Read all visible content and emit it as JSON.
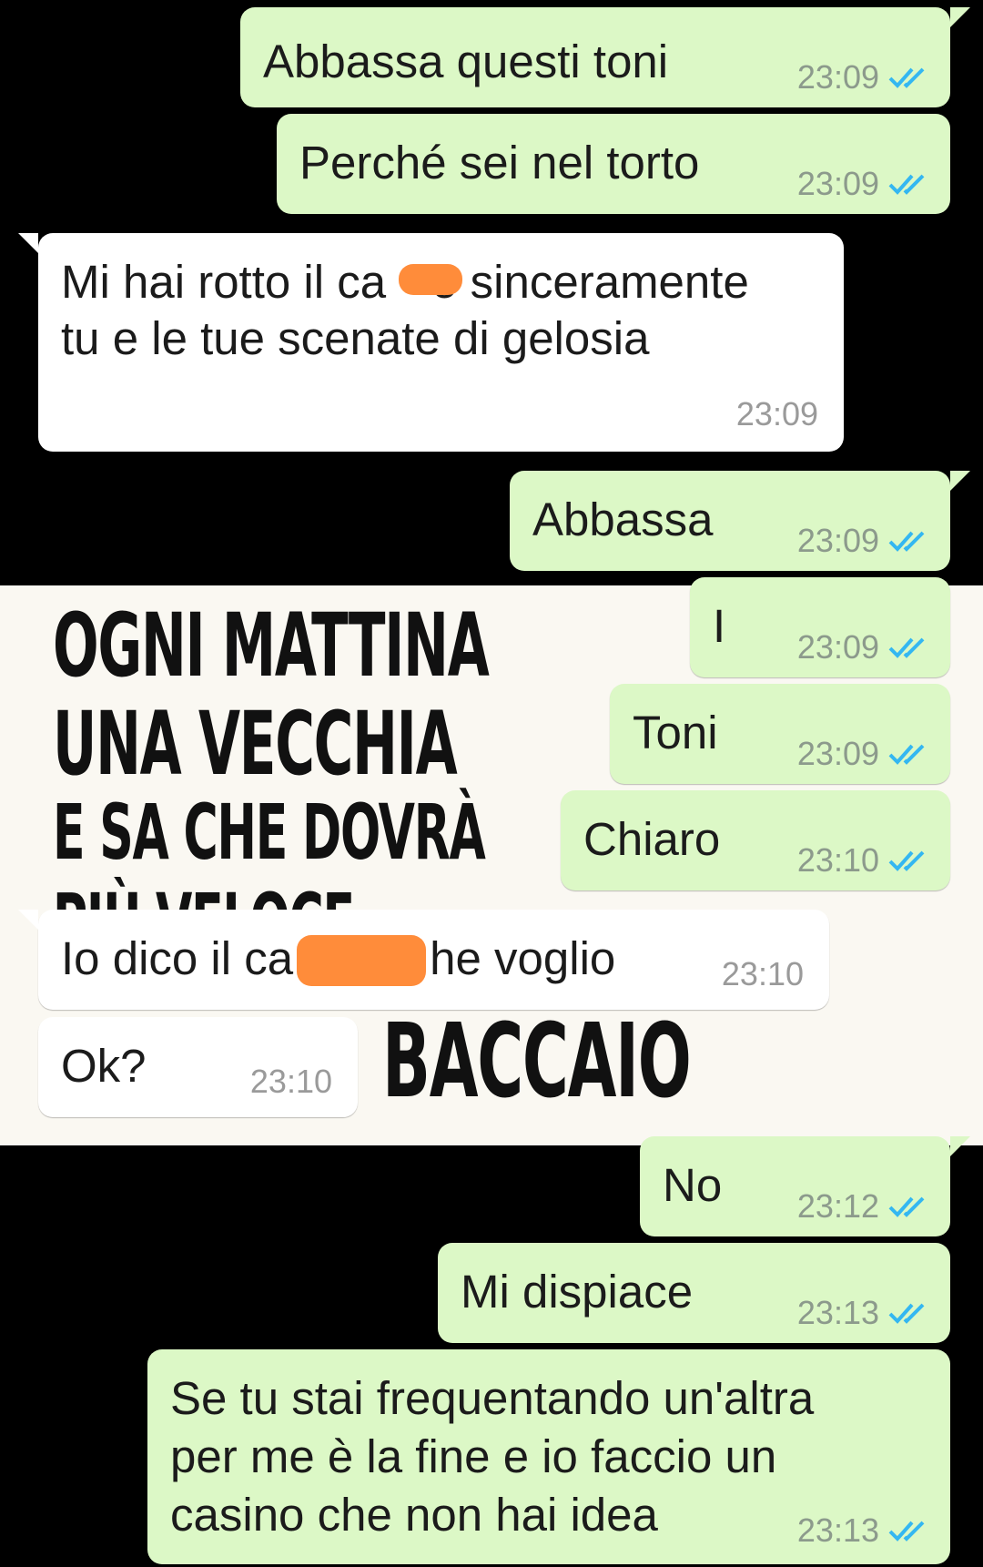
{
  "colors": {
    "background": "#000000",
    "outgoing_bubble": "#dcf8c6",
    "incoming_bubble": "#ffffff",
    "read_ticks": "#34b7f1",
    "redaction": "#ff8c3a",
    "banner_background": "#faf8f2"
  },
  "background_image": {
    "lines": [
      "OGNI MATTINA",
      "UNA VECCHIA",
      "E SA CHE DOVRÀ",
      "PIÙ VELOCE",
      "",
      "BACCAIO"
    ]
  },
  "messages": [
    {
      "direction": "out",
      "text": "Abbassa questi toni",
      "time": "23:09",
      "status_icon": "double-check-read"
    },
    {
      "direction": "out",
      "text": "Perché sei nel torto",
      "time": "23:09",
      "status_icon": "double-check-read"
    },
    {
      "direction": "in",
      "line1": "Mi hai rotto il ca",
      "line1_after": "o sinceramente",
      "line2": "tu e le tue scenate di gelosia",
      "time": "23:09"
    },
    {
      "direction": "out",
      "text": "Abbassa",
      "time": "23:09",
      "status_icon": "double-check-read"
    },
    {
      "direction": "out",
      "text": "I",
      "time": "23:09",
      "status_icon": "double-check-read"
    },
    {
      "direction": "out",
      "text": "Toni",
      "time": "23:09",
      "status_icon": "double-check-read"
    },
    {
      "direction": "out",
      "text": "Chiaro",
      "time": "23:10",
      "status_icon": "double-check-read"
    },
    {
      "direction": "in",
      "text_before": "Io dico il ca",
      "text_after": "he voglio",
      "time": "23:10"
    },
    {
      "direction": "in",
      "text": "Ok?",
      "time": "23:10"
    },
    {
      "direction": "out",
      "text": "No",
      "time": "23:12",
      "status_icon": "double-check-read"
    },
    {
      "direction": "out",
      "text": "Mi dispiace",
      "time": "23:13",
      "status_icon": "double-check-read"
    },
    {
      "direction": "out",
      "line1": "Se tu stai frequentando un'altra",
      "line2": "per me è la fine e io faccio un",
      "line3": "casino che non hai idea",
      "time": "23:13",
      "status_icon": "double-check-read"
    }
  ]
}
